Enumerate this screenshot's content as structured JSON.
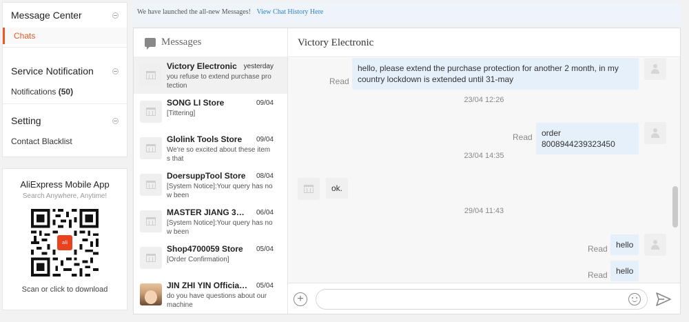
{
  "sidebar": {
    "message_center": {
      "title": "Message Center",
      "items": [
        {
          "label": "Chats"
        }
      ]
    },
    "service_notification": {
      "title": "Service Notification",
      "items": [
        {
          "label": "Notifications",
          "count": "(50)"
        }
      ]
    },
    "setting": {
      "title": "Setting",
      "items": [
        {
          "label": "Contact Blacklist"
        }
      ]
    }
  },
  "app_promo": {
    "title": "AliExpress Mobile App",
    "subtitle": "Search Anywhere, Anytime!",
    "qr_logo": "ali",
    "download_label": "Scan or click to download"
  },
  "banner": {
    "text": "We have launched the all-new Messages!",
    "link": "View Chat History Here"
  },
  "messages_list": {
    "title": "Messages",
    "conversations": [
      {
        "name": "Victory Electronic",
        "date": "yesterday",
        "preview": "you refuse to extend purchase protection",
        "selected": true
      },
      {
        "name": "SONG LI Store",
        "date": "09/04",
        "preview": "[Tittering]"
      },
      {
        "name": "Glolink Tools Store",
        "date": "09/04",
        "preview": "We're so excited about these items that"
      },
      {
        "name": "DoersuppTool Store",
        "date": "08/04",
        "preview": "[System Notice]:Your query has now been"
      },
      {
        "name": "MASTER JIANG 3S...",
        "date": "06/04",
        "preview": "[System Notice]:Your query has now been"
      },
      {
        "name": "Shop4700059 Store",
        "date": "05/04",
        "preview": "[Order Confirmation]"
      },
      {
        "name": "JIN ZHI YIN Official ...",
        "date": "05/04",
        "preview": "do you have questions about our machine"
      }
    ]
  },
  "conversation": {
    "title": "Victory Electronic",
    "messages": [
      {
        "from": "me",
        "status": "Read",
        "text": "hello, please extend the purchase protection for another 2 month, in my country lockdown is extended until 31-may"
      },
      {
        "timestamp": "23/04 12:26"
      },
      {
        "from": "me",
        "status": "Read",
        "text": "order 8008944239323450"
      },
      {
        "timestamp": "23/04 14:35"
      },
      {
        "from": "them",
        "text": "ok."
      },
      {
        "timestamp": "29/04 11:43"
      },
      {
        "from": "me",
        "status": "Read",
        "text": "hello"
      },
      {
        "from": "me",
        "status": "Read",
        "text": "hello"
      }
    ],
    "input_placeholder": ""
  },
  "colors": {
    "accent": "#e65a26",
    "link": "#2a82c9",
    "bubble_me": "#e6f0fb"
  }
}
